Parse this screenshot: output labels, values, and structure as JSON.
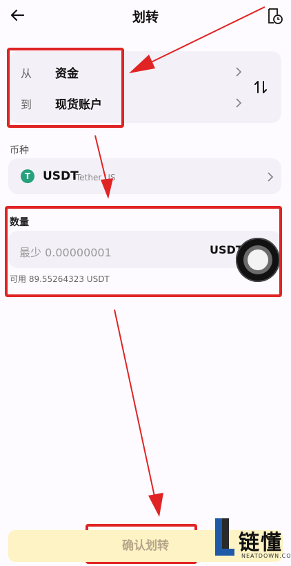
{
  "header": {
    "title": "划转"
  },
  "transfer": {
    "from_label": "从",
    "from_value": "资金",
    "to_label": "到",
    "to_value": "现货账户"
  },
  "coin": {
    "section_label": "币种",
    "symbol": "USDT",
    "name": "Tether US",
    "icon_glyph": "T"
  },
  "amount": {
    "section_label": "数量",
    "placeholder": "最少 0.00000001",
    "unit": "USDT",
    "available": "可用 89.55264323 USDT"
  },
  "confirm_button": {
    "label": "确认划转"
  },
  "watermark": {
    "text": "链懂",
    "sub": "NEATDOWN.COM"
  },
  "colors": {
    "accent_red": "#e02424",
    "confirm_bg": "#fdf3c4",
    "usdt_green": "#26a17b"
  }
}
